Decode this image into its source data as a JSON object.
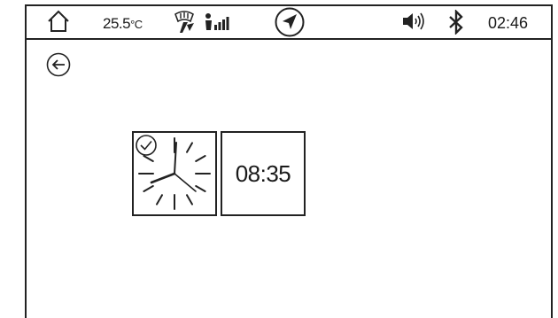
{
  "status_bar": {
    "temperature_value": "25.5",
    "temperature_unit": "°C",
    "time": "02:46",
    "icons": [
      "home-icon",
      "defrost-icon",
      "fan-speed-icon",
      "navigation-icon",
      "volume-icon",
      "bluetooth-icon"
    ]
  },
  "header": {
    "back_icon": "back-arrow-icon"
  },
  "widgets": {
    "analog_clock": {
      "selected": true,
      "icon": "check-circle-icon"
    },
    "digital_clock": {
      "time": "08:35"
    }
  },
  "colors": {
    "stroke": "#222222",
    "background": "#ffffff"
  }
}
